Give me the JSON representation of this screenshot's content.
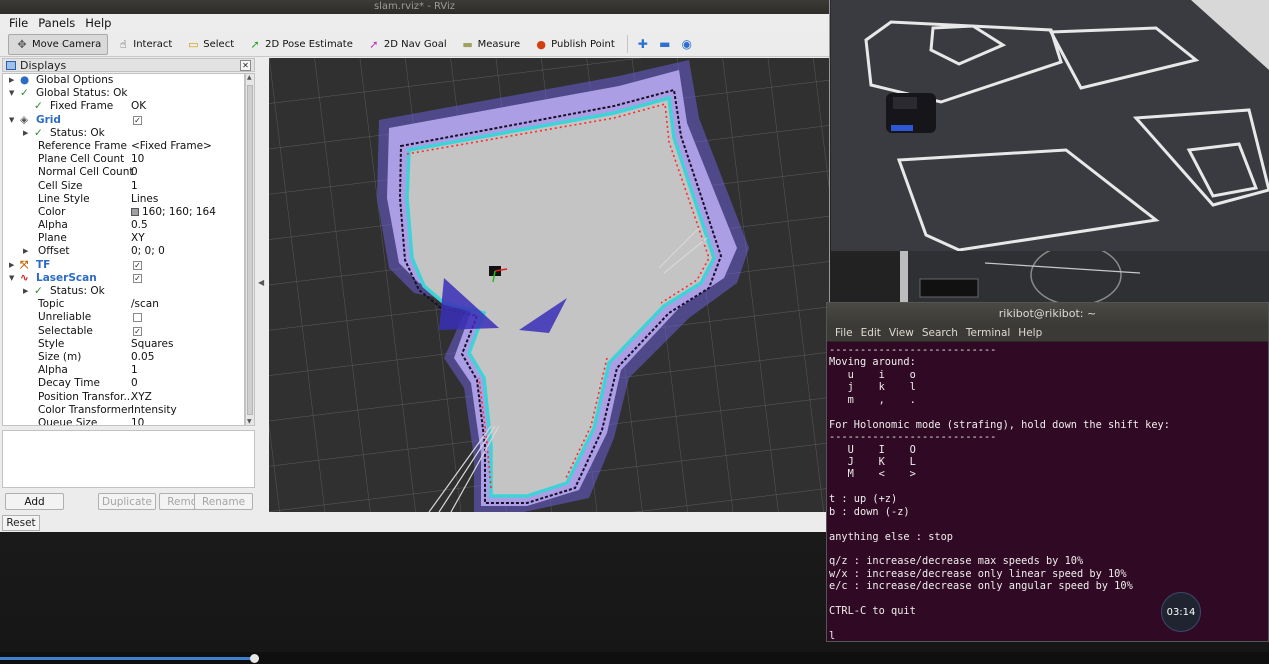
{
  "window": {
    "title": "slam.rviz* - RViz"
  },
  "menubar": [
    {
      "label": "File"
    },
    {
      "label": "Panels"
    },
    {
      "label": "Help"
    }
  ],
  "toolbar": {
    "tools": [
      {
        "label": "Move Camera",
        "icon": "move-camera-icon",
        "glyph": "✥",
        "color": "#555555",
        "active": true
      },
      {
        "label": "Interact",
        "icon": "hand-icon",
        "glyph": "☝",
        "color": "#333333",
        "active": false
      },
      {
        "label": "Select",
        "icon": "select-box-icon",
        "glyph": "▭",
        "color": "#c8a000",
        "active": false
      },
      {
        "label": "2D Pose Estimate",
        "icon": "green-arrow-icon",
        "glyph": "➚",
        "color": "#2fa52f",
        "active": false
      },
      {
        "label": "2D Nav Goal",
        "icon": "magenta-arrow-icon",
        "glyph": "➚",
        "color": "#c02fc0",
        "active": false
      },
      {
        "label": "Measure",
        "icon": "ruler-icon",
        "glyph": "▬",
        "color": "#a0a060",
        "active": false
      },
      {
        "label": "Publish Point",
        "icon": "map-pin-icon",
        "glyph": "●",
        "color": "#d04010",
        "active": false
      }
    ],
    "extra": [
      {
        "icon": "plus-icon",
        "glyph": "✚"
      },
      {
        "icon": "minus-icon",
        "glyph": "▬"
      },
      {
        "icon": "eye-icon",
        "glyph": "◉"
      }
    ]
  },
  "displays": {
    "header": "Displays",
    "rows": [
      {
        "indent": 0,
        "arrow": "▶",
        "icon": "globe",
        "label": "Global Options",
        "value": "",
        "style": ""
      },
      {
        "indent": 0,
        "arrow": "▼",
        "icon": "check",
        "label": "Global Status: Ok",
        "value": "",
        "style": ""
      },
      {
        "indent": 1,
        "arrow": "",
        "icon": "check",
        "label": "Fixed Frame",
        "value": "OK",
        "style": ""
      },
      {
        "indent": 0,
        "arrow": "▼",
        "icon": "grid",
        "label": "Grid",
        "value": "",
        "style": "blue",
        "checkbox": "✓"
      },
      {
        "indent": 1,
        "arrow": "▶",
        "icon": "check",
        "label": "Status: Ok",
        "value": "",
        "style": ""
      },
      {
        "indent": 1,
        "arrow": "",
        "icon": "",
        "label": "Reference Frame",
        "value": "<Fixed Frame>",
        "style": ""
      },
      {
        "indent": 1,
        "arrow": "",
        "icon": "",
        "label": "Plane Cell Count",
        "value": "10",
        "style": ""
      },
      {
        "indent": 1,
        "arrow": "",
        "icon": "",
        "label": "Normal Cell Count",
        "value": "0",
        "style": ""
      },
      {
        "indent": 1,
        "arrow": "",
        "icon": "",
        "label": "Cell Size",
        "value": "1",
        "style": ""
      },
      {
        "indent": 1,
        "arrow": "",
        "icon": "",
        "label": "Line Style",
        "value": "Lines",
        "style": ""
      },
      {
        "indent": 1,
        "arrow": "",
        "icon": "",
        "label": "Color",
        "value": "160; 160; 164",
        "style": "",
        "swatch": true
      },
      {
        "indent": 1,
        "arrow": "",
        "icon": "",
        "label": "Alpha",
        "value": "0.5",
        "style": ""
      },
      {
        "indent": 1,
        "arrow": "",
        "icon": "",
        "label": "Plane",
        "value": "XY",
        "style": ""
      },
      {
        "indent": 1,
        "arrow": "▶",
        "icon": "",
        "label": "Offset",
        "value": "0; 0; 0",
        "style": ""
      },
      {
        "indent": 0,
        "arrow": "▶",
        "icon": "tf",
        "label": "TF",
        "value": "",
        "style": "blue",
        "checkbox": "✓"
      },
      {
        "indent": 0,
        "arrow": "▼",
        "icon": "laser",
        "label": "LaserScan",
        "value": "",
        "style": "blue",
        "checkbox": "✓"
      },
      {
        "indent": 1,
        "arrow": "▶",
        "icon": "check",
        "label": "Status: Ok",
        "value": "",
        "style": ""
      },
      {
        "indent": 1,
        "arrow": "",
        "icon": "",
        "label": "Topic",
        "value": "/scan",
        "style": ""
      },
      {
        "indent": 1,
        "arrow": "",
        "icon": "",
        "label": "Unreliable",
        "value": "",
        "style": "",
        "checkbox": ""
      },
      {
        "indent": 1,
        "arrow": "",
        "icon": "",
        "label": "Selectable",
        "value": "",
        "style": "",
        "checkbox": "✓"
      },
      {
        "indent": 1,
        "arrow": "",
        "icon": "",
        "label": "Style",
        "value": "Squares",
        "style": ""
      },
      {
        "indent": 1,
        "arrow": "",
        "icon": "",
        "label": "Size (m)",
        "value": "0.05",
        "style": ""
      },
      {
        "indent": 1,
        "arrow": "",
        "icon": "",
        "label": "Alpha",
        "value": "1",
        "style": ""
      },
      {
        "indent": 1,
        "arrow": "",
        "icon": "",
        "label": "Decay Time",
        "value": "0",
        "style": ""
      },
      {
        "indent": 1,
        "arrow": "",
        "icon": "",
        "label": "Position Transfor...",
        "value": "XYZ",
        "style": ""
      },
      {
        "indent": 1,
        "arrow": "",
        "icon": "",
        "label": "Color Transformer",
        "value": "Intensity",
        "style": ""
      },
      {
        "indent": 1,
        "arrow": "",
        "icon": "",
        "label": "Queue Size",
        "value": "10",
        "style": ""
      }
    ],
    "buttons": [
      {
        "label": "Add",
        "disabled": false
      },
      {
        "label": "Duplicate",
        "disabled": true
      },
      {
        "label": "Remove",
        "disabled": true
      },
      {
        "label": "Rename",
        "disabled": true
      }
    ],
    "reset_label": "Reset"
  },
  "terminal": {
    "title": "rikibot@rikibot: ~",
    "menu": [
      "File",
      "Edit",
      "View",
      "Search",
      "Terminal",
      "Help"
    ],
    "lines": [
      "---------------------------",
      "Moving around:",
      "   u    i    o",
      "   j    k    l",
      "   m    ,    .",
      "",
      "For Holonomic mode (strafing), hold down the shift key:",
      "---------------------------",
      "   U    I    O",
      "   J    K    L",
      "   M    <    >",
      "",
      "t : up (+z)",
      "b : down (-z)",
      "",
      "anything else : stop",
      "",
      "q/z : increase/decrease max speeds by 10%",
      "w/x : increase/decrease only linear speed by 10%",
      "e/c : increase/decrease only angular speed by 10%",
      "",
      "CTRL-C to quit",
      "",
      "l"
    ]
  },
  "video": {
    "timer": "03:14",
    "progress": 0.2
  }
}
